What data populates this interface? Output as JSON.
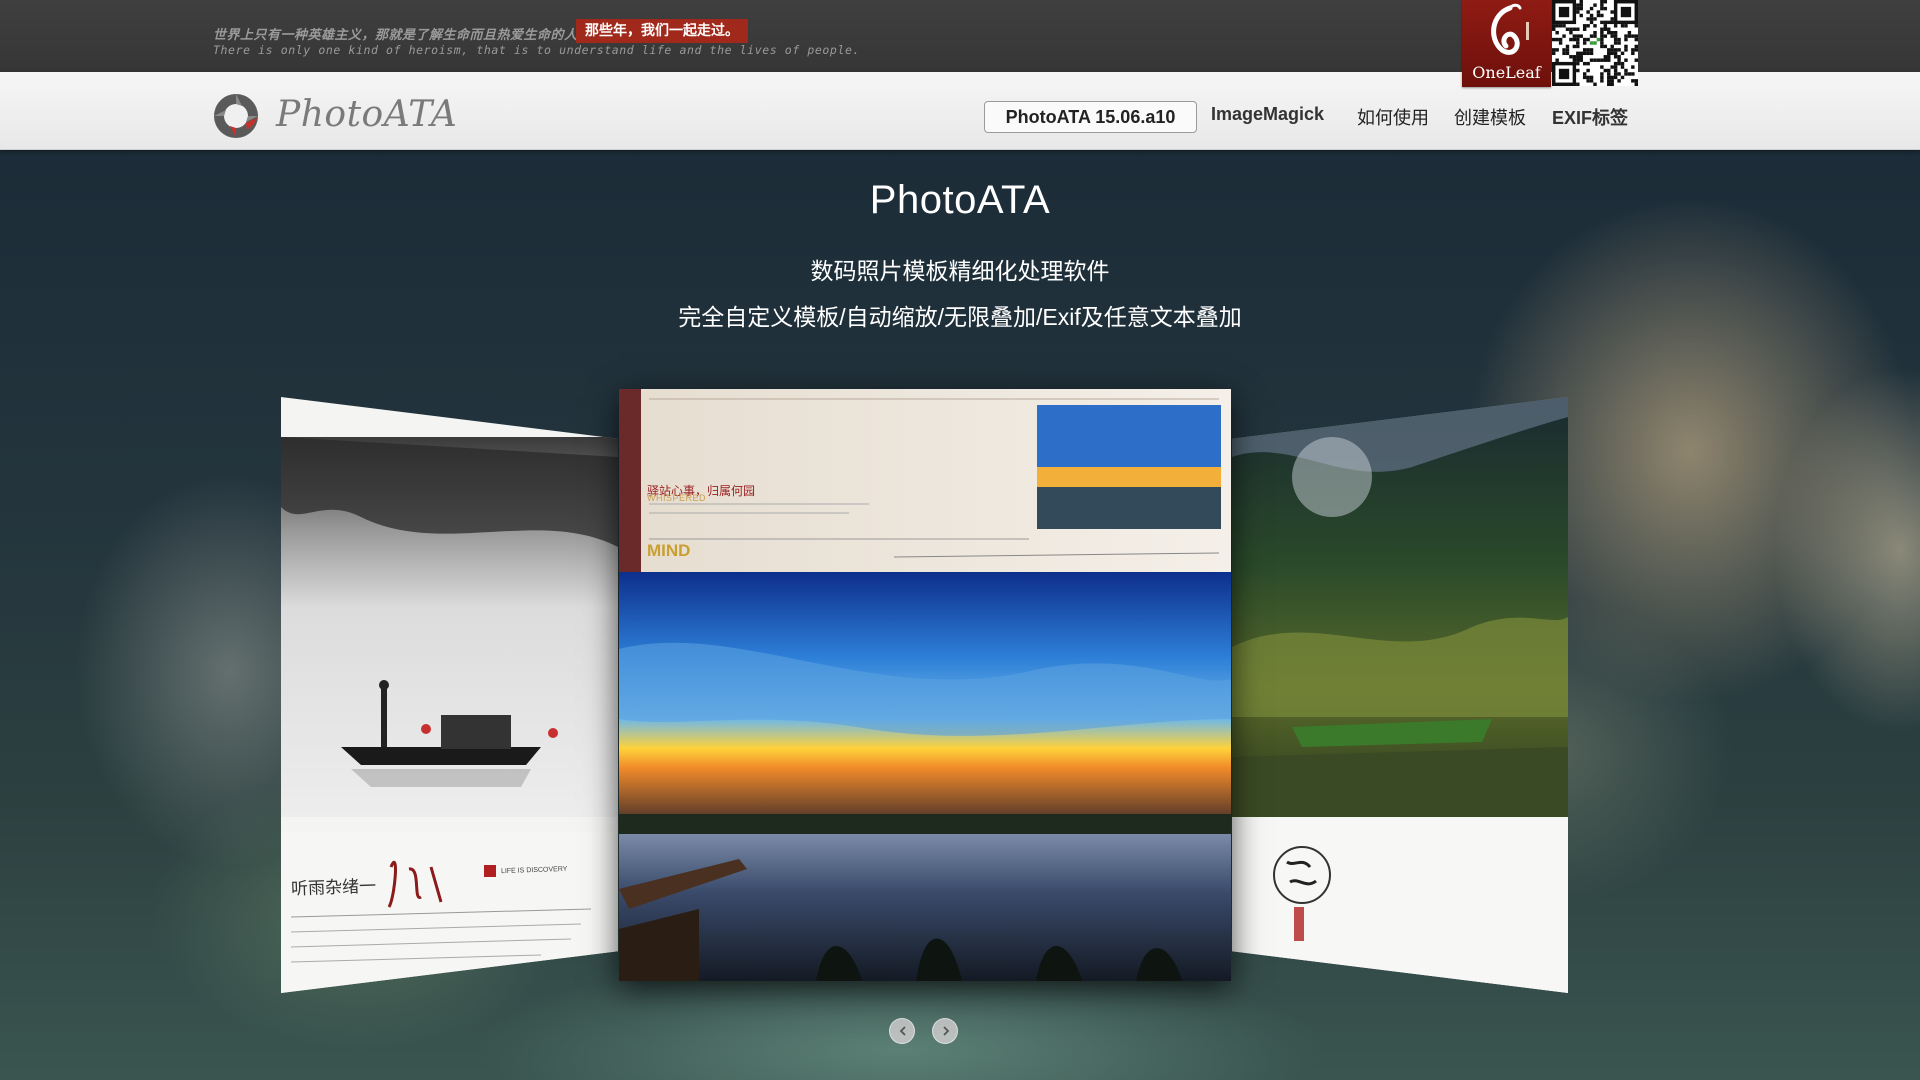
{
  "banner": {
    "slogan_cn": "世界上只有一种英雄主义，那就是了解生命而且热爱生命的人。",
    "slogan_tag": "那些年，我们一起走过。",
    "slogan_en": "There is only one kind of heroism, that is to understand life and the lives of people.",
    "oneleaf_logo_text": "OneLeaf"
  },
  "nav": {
    "logo_text": "PhotoATA",
    "version": "PhotoATA 15.06.a10",
    "items": [
      {
        "label": "ImageMagick"
      },
      {
        "label": "如何使用"
      },
      {
        "label": "创建模板"
      },
      {
        "label": "EXIF标签"
      }
    ]
  },
  "hero": {
    "title": "PhotoATA",
    "subtitle": "数码照片模板精细化处理软件",
    "features": "完全自定义模板/自动缩放/无限叠加/Exif及任意文本叠加"
  },
  "slides": {
    "left": {
      "caption": "听雨杂绪一",
      "tag": "LIFE IS DISCOVERY"
    },
    "center": {
      "whispered": "WHISPERED",
      "mind": "MIND"
    }
  },
  "colors": {
    "banner_bg": "#3b3b3b",
    "slogan_tag_bg": "#a0291b",
    "nav_bg": "#eeeeee",
    "logo_red": "#c9302c",
    "oneleaf_red": "#8f1b14"
  }
}
